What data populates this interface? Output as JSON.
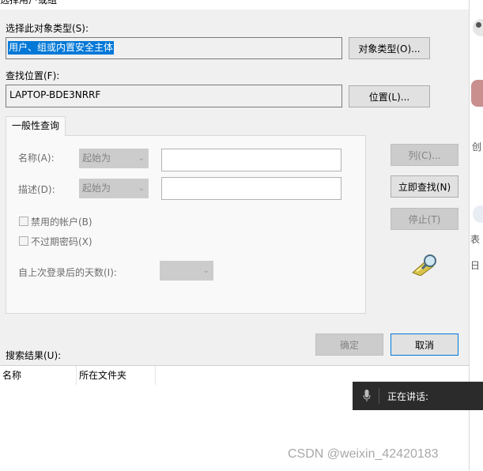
{
  "dialog": {
    "title_fragment": "选择用户或组",
    "object_type_label": "选择此对象类型(S):",
    "object_type_value": "用户、组或内置安全主体",
    "object_type_button": "对象类型(O)...",
    "location_label": "查找位置(F):",
    "location_value": "LAPTOP-BDE3NRRF",
    "location_button": "位置(L)...",
    "tab_label": "一般性查询",
    "name_label": "名称(A):",
    "name_combo": "起始为",
    "desc_label": "描述(D):",
    "desc_combo": "起始为",
    "disabled_accounts_label": "禁用的帐户(B)",
    "non_expiring_password_label": "不过期密码(X)",
    "days_since_logon_label": "自上次登录后的天数(I):",
    "columns_button": "列(C)...",
    "find_now_button": "立即查找(N)",
    "stop_button": "停止(T)",
    "ok_button": "确定",
    "cancel_button": "取消",
    "search_results_label": "搜索结果(U):",
    "results_columns": [
      "名称",
      "所在文件夹"
    ]
  },
  "side_panel": {
    "char_create": "创",
    "char_table": "表",
    "char_day": "日"
  },
  "speech_bar": {
    "status_text": "正在讲话:"
  },
  "watermark": {
    "text": "CSDN @weixin_42420183"
  },
  "colors": {
    "dialog_bg": "#f0f0f0",
    "selection_blue": "#0078d7",
    "speech_bar_bg": "#2b2b2b"
  }
}
